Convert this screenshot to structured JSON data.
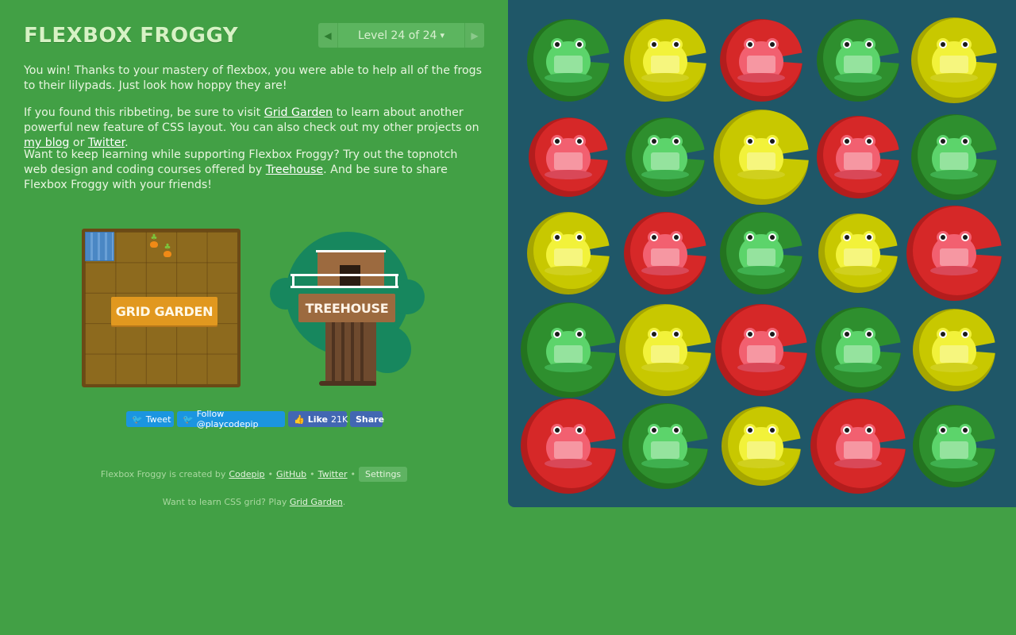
{
  "header": {
    "title": "FLEXBOX FROGGY",
    "level_indicator": "Level 24 of 24",
    "caret": "▾",
    "prev_arrow": "◀",
    "next_arrow": "▶"
  },
  "win_text": {
    "p1": "You win! Thanks to your mastery of flexbox, you were able to help all of the frogs to their lilypads. Just look how hoppy they are!",
    "p2_before": "If you found this ribbeting, be sure to visit ",
    "p2_link1": "Grid Garden",
    "p2_middle": " to learn about another powerful new feature of CSS layout. You can also check out my other projects on ",
    "p2_link2": "my blog",
    "p2_or": " or ",
    "p2_link3": "Twitter",
    "p2_end": ".",
    "p3_before": "Want to keep learning while supporting Flexbox Froggy? Try out the topnotch web design and coding courses offered by ",
    "p3_link": "Treehouse",
    "p3_after": ". And be sure to share Flexbox Froggy with your friends!"
  },
  "promos": {
    "grid_garden_label": "GRID GARDEN",
    "treehouse_label": "TREEHOUSE"
  },
  "social": {
    "tweet": "Tweet",
    "follow": "Follow @playcodepip",
    "like": "Like",
    "like_count": "21K",
    "share": "Share"
  },
  "footer": {
    "created_by": "Flexbox Froggy is created by",
    "link_codepip": "Codepip",
    "sep": "•",
    "link_github": "GitHub",
    "link_twitter": "Twitter",
    "settings": "Settings",
    "learn_before": "Want to learn CSS grid? Play",
    "learn_link": "Grid Garden",
    "learn_after": "."
  },
  "colors": {
    "background": "#42a045",
    "pond": "#1f5768",
    "frog_green": "#5cd46b",
    "frog_yellow": "#f2f23a",
    "frog_red": "#f26070",
    "pad_green": "#2e8f2e",
    "pad_yellow": "#c8c800",
    "pad_red": "#d62828"
  },
  "pond": {
    "rows": [
      [
        "green",
        "yellow",
        "red",
        "green",
        "yellow"
      ],
      [
        "red",
        "green",
        "yellow",
        "red",
        "green"
      ],
      [
        "yellow",
        "red",
        "green",
        "yellow",
        "red"
      ],
      [
        "green",
        "yellow",
        "red",
        "green",
        "yellow"
      ],
      [
        "red",
        "green",
        "yellow",
        "red",
        "green"
      ]
    ]
  }
}
